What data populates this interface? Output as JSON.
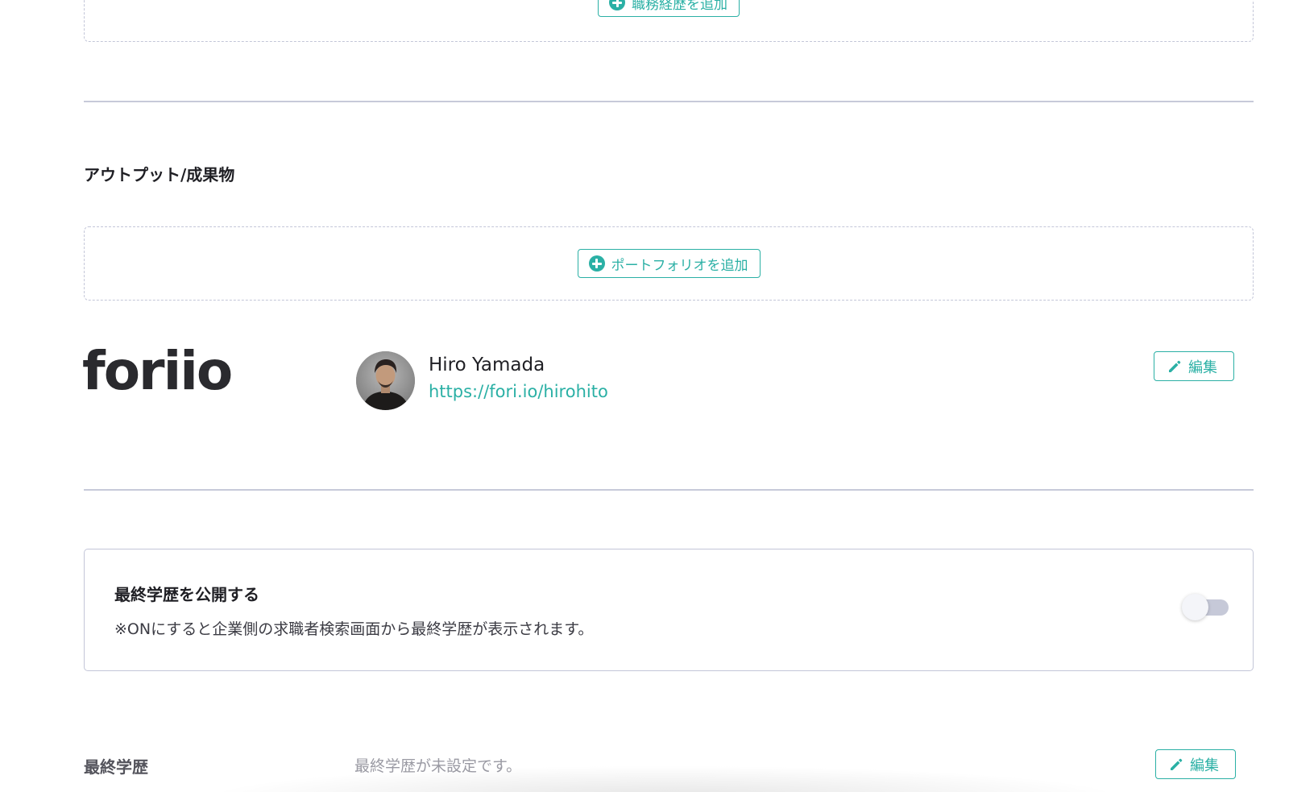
{
  "career": {
    "add_button_label": "職務経歴を追加"
  },
  "output_section": {
    "title": "アウトプット/成果物",
    "add_portfolio_label": "ポートフォリオを追加"
  },
  "foriio": {
    "logo_text": "foriio",
    "profile_name": "Hiro Yamada",
    "profile_url": "https://fori.io/hirohito",
    "edit_label": "編集"
  },
  "education_publish": {
    "title": "最終学歴を公開する",
    "description": "※ONにすると企業側の求職者検索画面から最終学歴が表示されます。",
    "toggle_on": false
  },
  "education": {
    "label": "最終学歴",
    "value": "最終学歴が未設定です。",
    "edit_label": "編集"
  },
  "colors": {
    "accent": "#2bb0a5",
    "border": "#c3c6d8",
    "text": "#1f1f24",
    "muted": "#9a9aa3"
  },
  "icons": {
    "add": "plus-circle-icon",
    "edit": "pencil-icon"
  }
}
